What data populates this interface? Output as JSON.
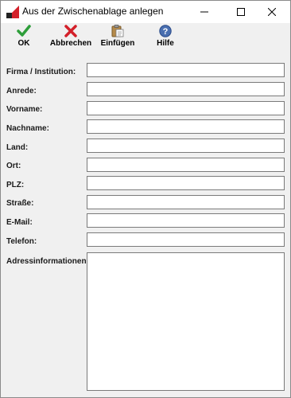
{
  "window": {
    "title": "Aus der Zwischenablage anlegen",
    "controls": [
      "minimize-icon",
      "maximize-icon",
      "close-icon"
    ]
  },
  "toolbar": {
    "ok": {
      "label": "OK",
      "icon": "checkmark-icon",
      "color": "#2e9e3a"
    },
    "cancel": {
      "label": "Abbrechen",
      "icon": "red-x-icon",
      "color": "#d3202a"
    },
    "paste": {
      "label": "Einfügen",
      "icon": "clipboard-paste-icon",
      "color": "#b58a4a"
    },
    "help": {
      "label": "Hilfe",
      "icon": "help-icon",
      "color": "#4a6fb0"
    }
  },
  "form": {
    "fields": [
      {
        "label": "Firma / Institution:",
        "value": ""
      },
      {
        "label": "Anrede:",
        "value": ""
      },
      {
        "label": "Vorname:",
        "value": ""
      },
      {
        "label": "Nachname:",
        "value": ""
      },
      {
        "label": "Land:",
        "value": ""
      },
      {
        "label": "Ort:",
        "value": ""
      },
      {
        "label": "PLZ:",
        "value": ""
      },
      {
        "label": "Straße:",
        "value": ""
      },
      {
        "label": "E-Mail:",
        "value": ""
      },
      {
        "label": "Telefon:",
        "value": ""
      }
    ],
    "address_info": {
      "label": "Adressinformationen:",
      "value": ""
    }
  }
}
